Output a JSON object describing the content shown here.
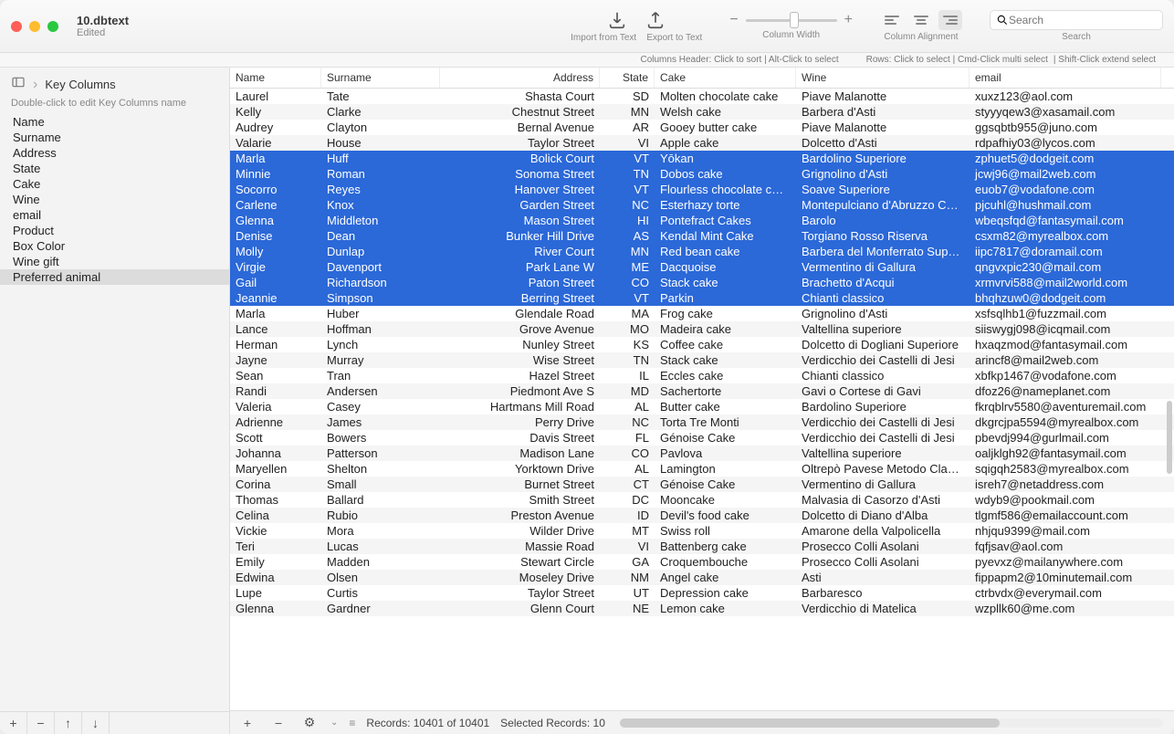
{
  "window": {
    "title": "10.dbtext",
    "subtitle": "Edited"
  },
  "toolbar": {
    "import_label": "Import from Text",
    "export_label": "Export to Text",
    "column_width_label": "Column Width",
    "column_align_label": "Column Alignment",
    "search_label": "Search",
    "search_placeholder": "Search"
  },
  "hints": {
    "columns": "Columns Header: Click to sort | Alt-Click to select",
    "rows_a": "Rows: Click to select | Cmd-Click multi select",
    "rows_b": "| Shift-Click extend select"
  },
  "sidebar": {
    "title": "Key Columns",
    "hint": "Double-click to edit Key Columns name",
    "items": [
      "Name",
      "Surname",
      "Address",
      "State",
      "Cake",
      "Wine",
      "email",
      "Product",
      "Box Color",
      "Wine gift",
      "Preferred animal"
    ],
    "selected_index": 10
  },
  "columns": [
    "Name",
    "Surname",
    "Address",
    "State",
    "Cake",
    "Wine",
    "email"
  ],
  "selected_row_indexes": [
    4,
    5,
    6,
    7,
    8,
    9,
    10,
    11,
    12,
    13
  ],
  "rows": [
    [
      "Laurel",
      "Tate",
      "Shasta Court",
      "SD",
      "Molten chocolate cake",
      "Piave Malanotte",
      "xuxz123@aol.com"
    ],
    [
      "Kelly",
      "Clarke",
      "Chestnut Street",
      "MN",
      "Welsh cake",
      "Barbera d'Asti",
      "styyyqew3@xasamail.com"
    ],
    [
      "Audrey",
      "Clayton",
      "Bernal Avenue",
      "AR",
      "Gooey butter cake",
      "Piave Malanotte",
      "ggsqbtb955@juno.com"
    ],
    [
      "Valarie",
      "House",
      "Taylor Street",
      "VI",
      "Apple cake",
      "Dolcetto d'Asti",
      "rdpafhiy03@lycos.com"
    ],
    [
      "Marla",
      "Huff",
      "Bolick Court",
      "VT",
      "Yōkan",
      "Bardolino Superiore",
      "zphuet5@dodgeit.com"
    ],
    [
      "Minnie",
      "Roman",
      "Sonoma Street",
      "TN",
      "Dobos cake",
      "Grignolino d'Asti",
      "jcwj96@mail2web.com"
    ],
    [
      "Socorro",
      "Reyes",
      "Hanover Street",
      "VT",
      "Flourless chocolate c…",
      "Soave Superiore",
      "euob7@vodafone.com"
    ],
    [
      "Carlene",
      "Knox",
      "Garden Street",
      "NC",
      "Esterhazy torte",
      "Montepulciano d'Abruzzo C…",
      "pjcuhl@hushmail.com"
    ],
    [
      "Glenna",
      "Middleton",
      "Mason Street",
      "HI",
      "Pontefract Cakes",
      "Barolo",
      "wbeqsfqd@fantasymail.com"
    ],
    [
      "Denise",
      "Dean",
      "Bunker Hill Drive",
      "AS",
      "Kendal Mint Cake",
      "Torgiano Rosso Riserva",
      "csxm82@myrealbox.com"
    ],
    [
      "Molly",
      "Dunlap",
      "River Court",
      "MN",
      "Red bean cake",
      "Barbera del Monferrato Sup…",
      "iipc7817@doramail.com"
    ],
    [
      "Virgie",
      "Davenport",
      "Park Lane W",
      "ME",
      "Dacquoise",
      "Vermentino di Gallura",
      "qngvxpic230@mail.com"
    ],
    [
      "Gail",
      "Richardson",
      "Paton Street",
      "CO",
      "Stack cake",
      "Brachetto d'Acqui",
      "xrmvrvi588@mail2world.com"
    ],
    [
      "Jeannie",
      "Simpson",
      "Berring Street",
      "VT",
      "Parkin",
      "Chianti classico",
      "bhqhzuw0@dodgeit.com"
    ],
    [
      "Marla",
      "Huber",
      "Glendale Road",
      "MA",
      "Frog cake",
      "Grignolino d'Asti",
      "xsfsqlhb1@fuzzmail.com"
    ],
    [
      "Lance",
      "Hoffman",
      "Grove Avenue",
      "MO",
      "Madeira cake",
      "Valtellina superiore",
      "siiswygj098@icqmail.com"
    ],
    [
      "Herman",
      "Lynch",
      "Nunley Street",
      "KS",
      "Coffee cake",
      "Dolcetto di Dogliani Superiore",
      "hxaqzmod@fantasymail.com"
    ],
    [
      "Jayne",
      "Murray",
      "Wise Street",
      "TN",
      "Stack cake",
      "Verdicchio dei Castelli di Jesi",
      "arincf8@mail2web.com"
    ],
    [
      "Sean",
      "Tran",
      "Hazel Street",
      "IL",
      "Eccles cake",
      "Chianti classico",
      "xbfkp1467@vodafone.com"
    ],
    [
      "Randi",
      "Andersen",
      "Piedmont Ave S",
      "MD",
      "Sachertorte",
      "Gavi o Cortese di Gavi",
      "dfoz26@nameplanet.com"
    ],
    [
      "Valeria",
      "Casey",
      "Hartmans Mill Road",
      "AL",
      "Butter cake",
      "Bardolino Superiore",
      "fkrqblrv5580@aventuremail.com"
    ],
    [
      "Adrienne",
      "James",
      "Perry Drive",
      "NC",
      "Torta Tre Monti",
      "Verdicchio dei Castelli di Jesi",
      "dkgrcjpa5594@myrealbox.com"
    ],
    [
      "Scott",
      "Bowers",
      "Davis Street",
      "FL",
      "Génoise Cake",
      "Verdicchio dei Castelli di Jesi",
      "pbevdj994@gurlmail.com"
    ],
    [
      "Johanna",
      "Patterson",
      "Madison Lane",
      "CO",
      "Pavlova",
      "Valtellina superiore",
      "oaljklgh92@fantasymail.com"
    ],
    [
      "Maryellen",
      "Shelton",
      "Yorktown Drive",
      "AL",
      "Lamington",
      "Oltrepò Pavese Metodo Clas…",
      "sqigqh2583@myrealbox.com"
    ],
    [
      "Corina",
      "Small",
      "Burnet Street",
      "CT",
      "Génoise Cake",
      "Vermentino di Gallura",
      "isreh7@netaddress.com"
    ],
    [
      "Thomas",
      "Ballard",
      "Smith Street",
      "DC",
      "Mooncake",
      "Malvasia di Casorzo d'Asti",
      "wdyb9@pookmail.com"
    ],
    [
      "Celina",
      "Rubio",
      "Preston Avenue",
      "ID",
      "Devil's food cake",
      "Dolcetto di Diano d'Alba",
      "tlgmf586@emailaccount.com"
    ],
    [
      "Vickie",
      "Mora",
      "Wilder Drive",
      "MT",
      "Swiss roll",
      "Amarone della Valpolicella",
      "nhjqu9399@mail.com"
    ],
    [
      "Teri",
      "Lucas",
      "Massie Road",
      "VI",
      "Battenberg cake",
      "Prosecco Colli Asolani",
      "fqfjsav@aol.com"
    ],
    [
      "Emily",
      "Madden",
      "Stewart Circle",
      "GA",
      "Croquembouche",
      "Prosecco Colli Asolani",
      "pyevxz@mailanywhere.com"
    ],
    [
      "Edwina",
      "Olsen",
      "Moseley Drive",
      "NM",
      "Angel cake",
      "Asti",
      "fippapm2@10minutemail.com"
    ],
    [
      "Lupe",
      "Curtis",
      "Taylor Street",
      "UT",
      "Depression cake",
      "Barbaresco",
      "ctrbvdx@everymail.com"
    ],
    [
      "Glenna",
      "Gardner",
      "Glenn Court",
      "NE",
      "Lemon cake",
      "Verdicchio di Matelica",
      "wzpllk60@me.com"
    ]
  ],
  "status": {
    "records": "Records: 10401 of 10401",
    "selected": "Selected Records: 10"
  }
}
